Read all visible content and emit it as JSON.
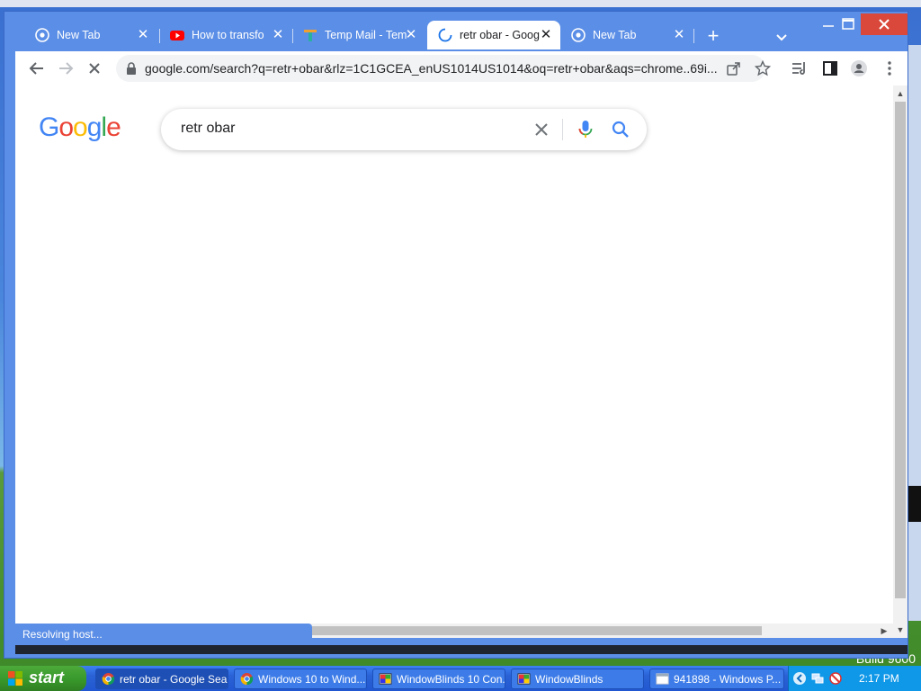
{
  "desktop": {
    "build_label": "Build 9600"
  },
  "browser": {
    "tabs": [
      {
        "label": "New Tab",
        "icon": "chrome-icon",
        "active": false
      },
      {
        "label": "How to transfo",
        "icon": "youtube-icon",
        "active": false
      },
      {
        "label": "Temp Mail - Tem",
        "icon": "tempmail-icon",
        "active": false
      },
      {
        "label": "retr obar - Goog",
        "icon": "loading-spinner-icon",
        "active": true
      },
      {
        "label": "New Tab",
        "icon": "chrome-icon",
        "active": false
      }
    ],
    "address": {
      "url": "google.com/search?q=retr+obar&rlz=1C1GCEA_enUS1014US1014&oq=retr+obar&aqs=chrome..69i..."
    },
    "status_text": "Resolving host..."
  },
  "google": {
    "logo_letters": [
      "G",
      "o",
      "o",
      "g",
      "l",
      "e"
    ],
    "query": "retr obar"
  },
  "taskbar": {
    "start_label": "start",
    "items": [
      {
        "label": "retr obar - Google Sea...",
        "icon": "chrome-icon",
        "active": true
      },
      {
        "label": "Windows 10 to Wind...",
        "icon": "chrome-icon",
        "active": false
      },
      {
        "label": "WindowBlinds 10 Con...",
        "icon": "windowblinds-icon",
        "active": false
      },
      {
        "label": "WindowBlinds",
        "icon": "windowblinds-icon",
        "active": false
      },
      {
        "label": "941898 - Windows P...",
        "icon": "window-icon",
        "active": false
      }
    ],
    "clock": "2:17 PM"
  },
  "colors": {
    "tab_strip": "#5b8ee6",
    "google_blue": "#4285f4",
    "google_red": "#ea4335",
    "google_yellow": "#fbbc05",
    "google_green": "#34a853",
    "close_red": "#d9483a"
  }
}
